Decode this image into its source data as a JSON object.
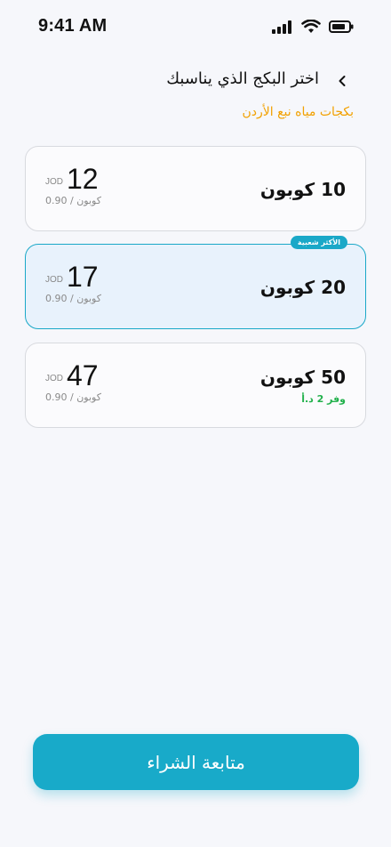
{
  "status_bar": {
    "time": "9:41 AM"
  },
  "header": {
    "title": "اختر البكج الذي يناسبك",
    "subtitle": "بكجات مياه نبع الأردن"
  },
  "packages": [
    {
      "quantity_label": "10 كوبون",
      "price": "12",
      "currency": "JOD",
      "unit_price": "0.90 / كوبون",
      "selected": false
    },
    {
      "quantity_label": "20 كوبون",
      "price": "17",
      "currency": "JOD",
      "unit_price": "0.90 / كوبون",
      "selected": true,
      "badge": "الأكثر شعبية"
    },
    {
      "quantity_label": "50 كوبون",
      "price": "47",
      "currency": "JOD",
      "unit_price": "0.90 / كوبون",
      "selected": false,
      "savings": "وفر 2 د.أ"
    }
  ],
  "cta": {
    "label": "متابعة الشراء"
  },
  "colors": {
    "accent": "#18aac9",
    "subtitle": "#f2a100",
    "savings": "#22b14c",
    "selected_bg": "#e8f2fc"
  },
  "icons": {
    "back": "chevron-left-icon",
    "signal": "cellular-signal-icon",
    "wifi": "wifi-icon",
    "battery": "battery-icon"
  }
}
